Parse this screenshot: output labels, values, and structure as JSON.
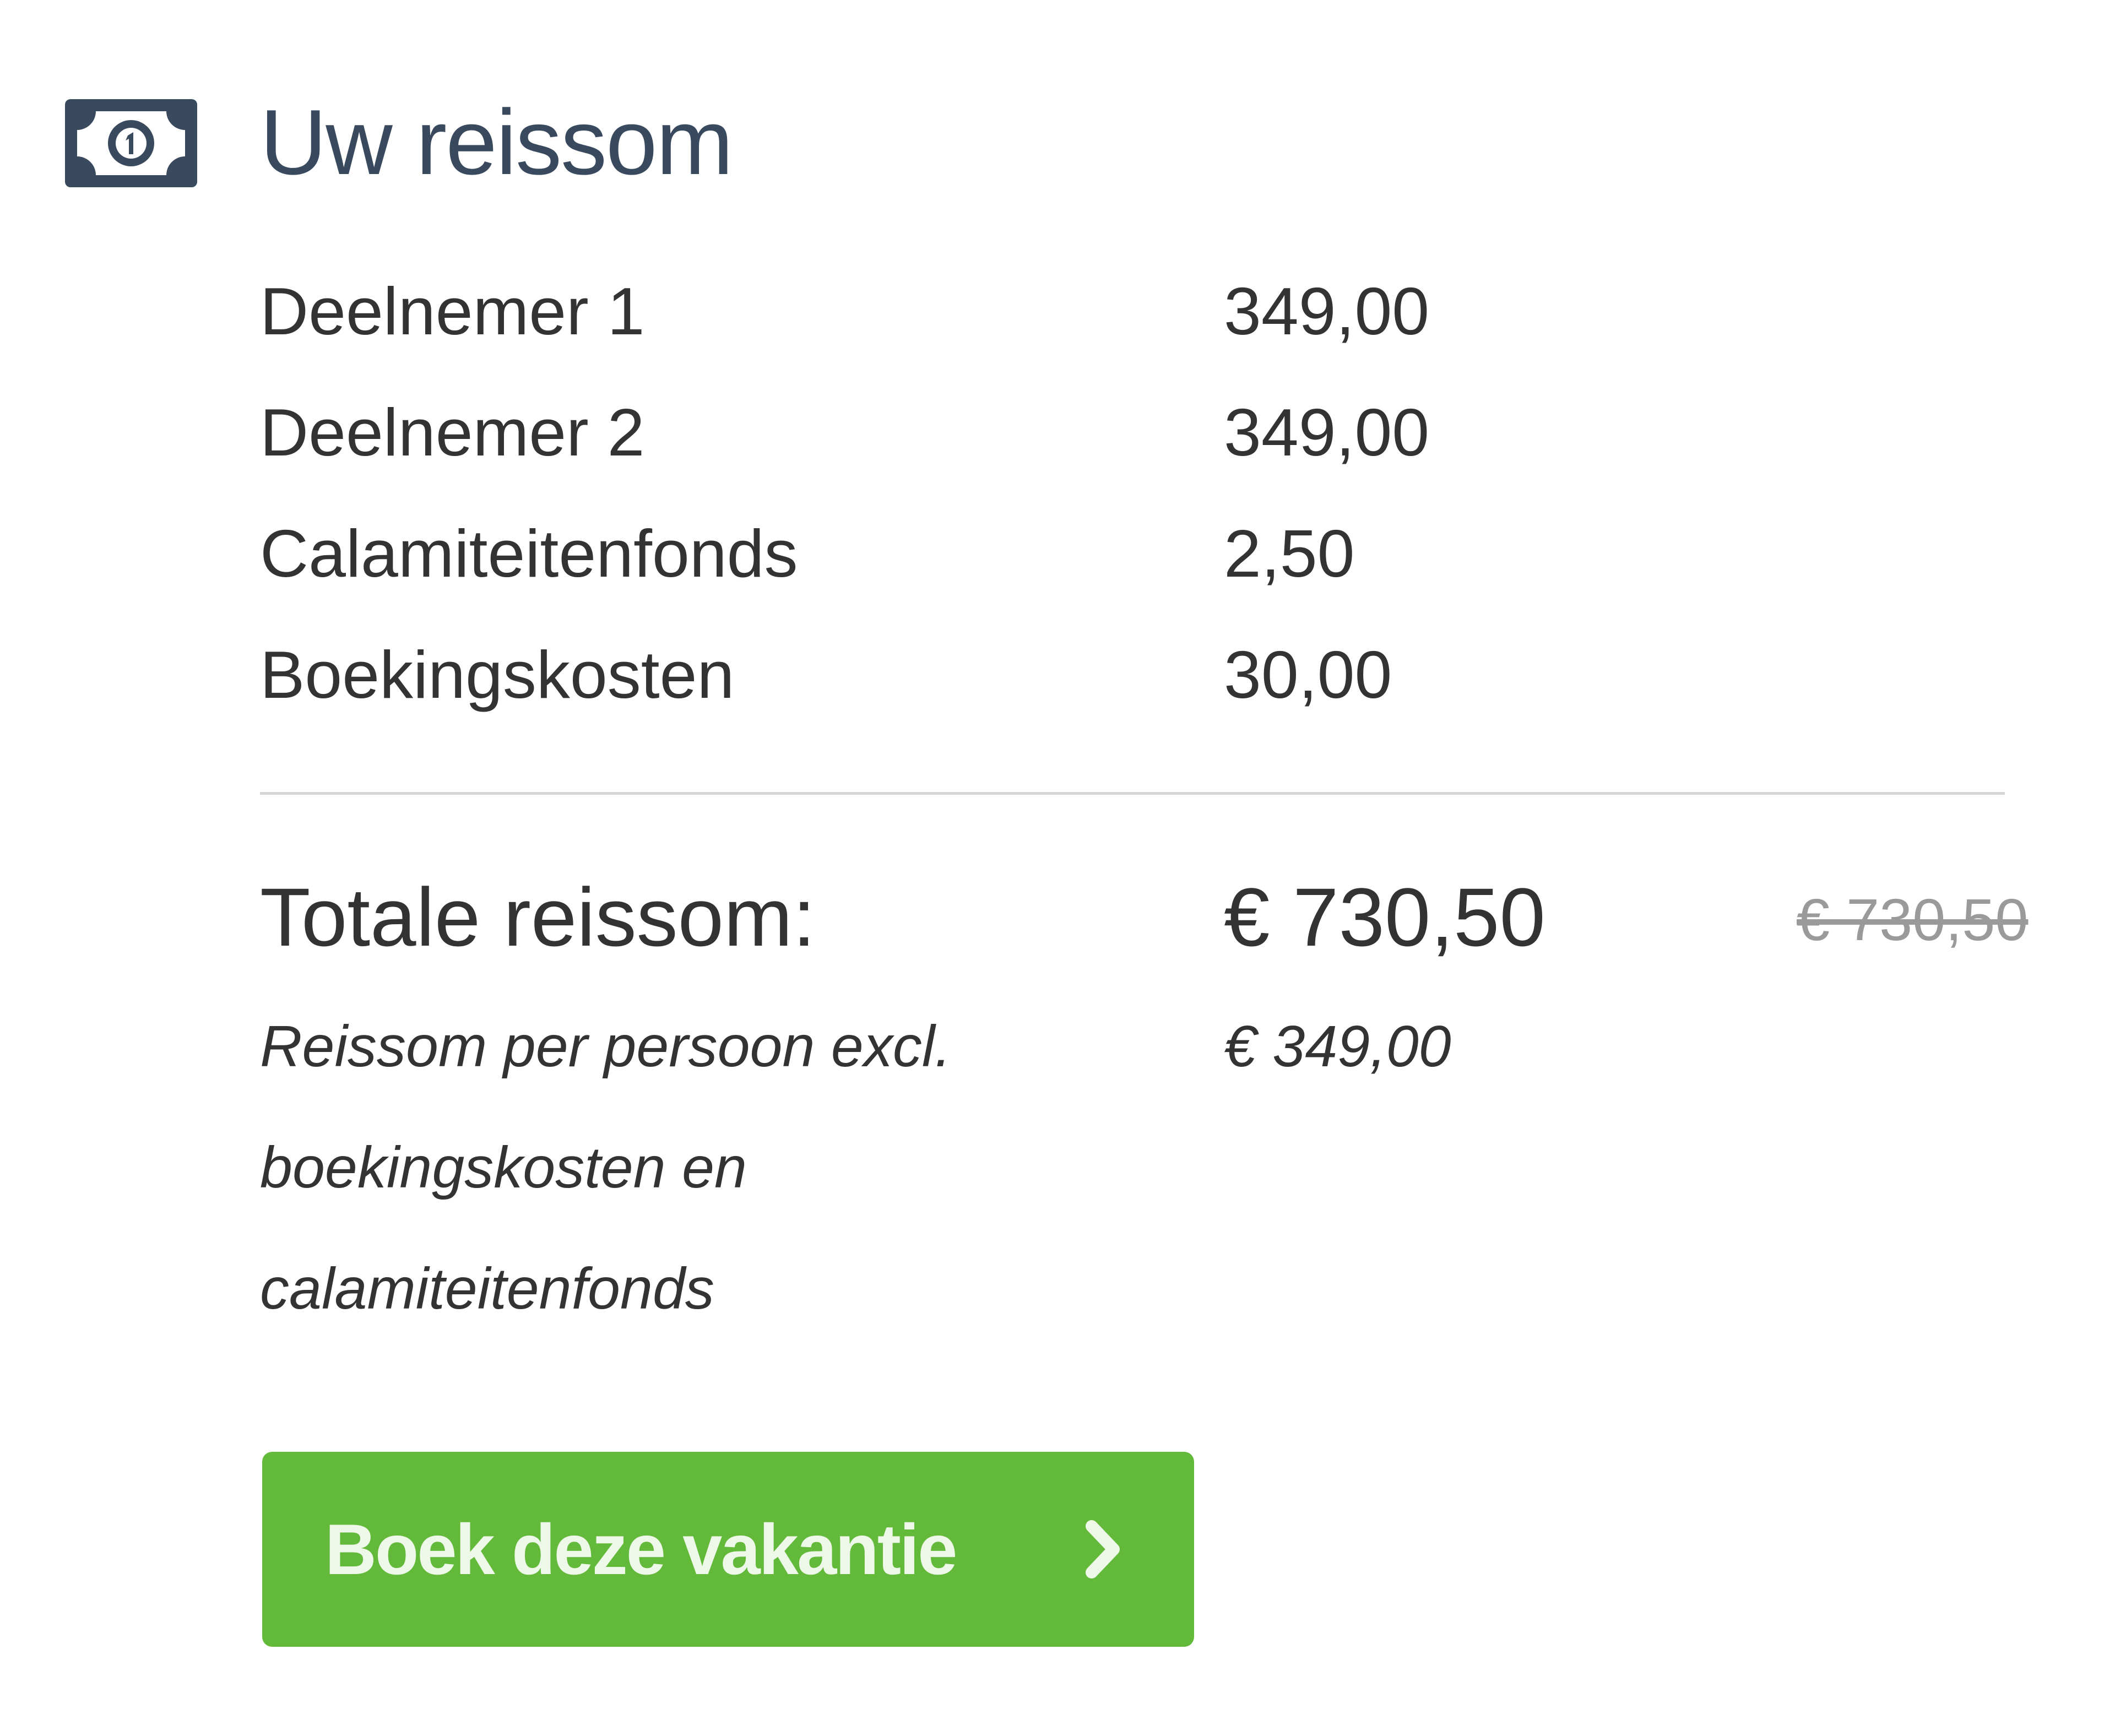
{
  "header": {
    "icon": "money-bill-icon",
    "title": "Uw reissom"
  },
  "lines": [
    {
      "label": "Deelnemer 1",
      "value": "349,00"
    },
    {
      "label": "Deelnemer 2",
      "value": "349,00"
    },
    {
      "label": "Calamiteitenfonds",
      "value": "2,50"
    },
    {
      "label": "Boekingskosten",
      "value": "30,00"
    }
  ],
  "total": {
    "label": "Totale reissom:",
    "value": "€ 730,50",
    "old_value": "€ 730,50"
  },
  "per_person": {
    "note_lines": [
      "Reissom per persoon excl.",
      "boekingskosten en",
      "calamiteitenfonds"
    ],
    "value": "€ 349,00"
  },
  "book_button": {
    "label": "Boek deze vakantie",
    "icon": "chevron-right-icon"
  },
  "colors": {
    "title": "#3a4a5e",
    "button": "#63b93a",
    "text": "#333333",
    "divider": "#d5d5d5",
    "old_price": "#9a9a9a"
  }
}
